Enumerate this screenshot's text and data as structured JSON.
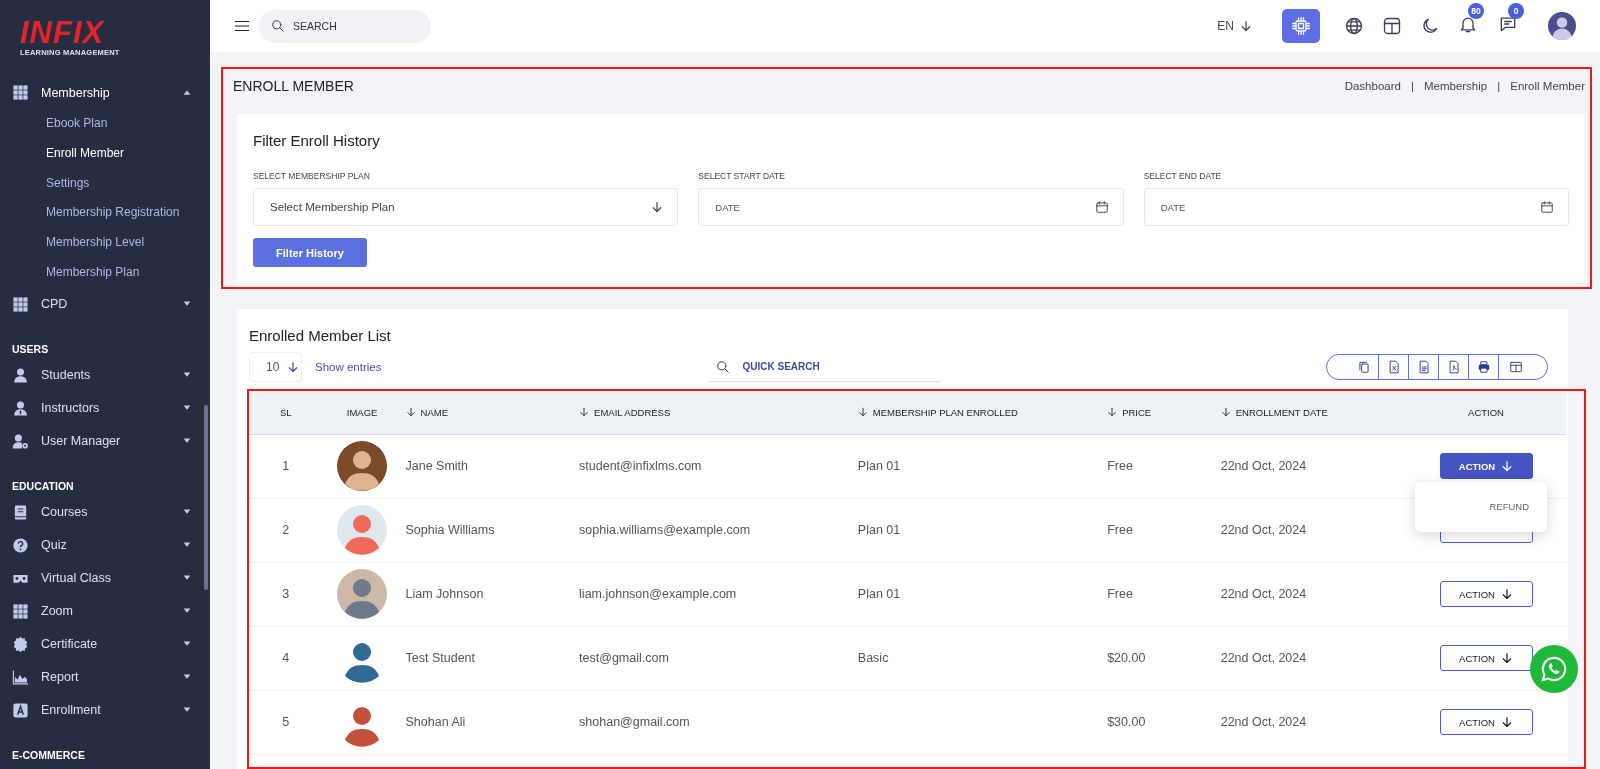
{
  "sidebar": {
    "logo": {
      "title": "INFIX",
      "subtitle": "LEARNING MANAGEMENT"
    },
    "sections": [
      {
        "items": [
          {
            "label": "Membership",
            "expanded": true,
            "children": [
              {
                "label": "Ebook Plan",
                "selected": false
              },
              {
                "label": "Enroll Member",
                "selected": true
              },
              {
                "label": "Settings",
                "selected": false
              },
              {
                "label": "Membership Registration",
                "selected": false
              },
              {
                "label": "Membership Level",
                "selected": false
              },
              {
                "label": "Membership Plan",
                "selected": false
              }
            ]
          },
          {
            "label": "CPD",
            "expanded": false
          }
        ]
      },
      {
        "heading": "USERS",
        "items": [
          {
            "label": "Students",
            "expanded": false
          },
          {
            "label": "Instructors",
            "expanded": false
          },
          {
            "label": "User Manager",
            "expanded": false
          }
        ]
      },
      {
        "heading": "EDUCATION",
        "items": [
          {
            "label": "Courses",
            "expanded": false
          },
          {
            "label": "Quiz",
            "expanded": false
          },
          {
            "label": "Virtual Class",
            "expanded": false
          },
          {
            "label": "Zoom",
            "expanded": false
          },
          {
            "label": "Certificate",
            "expanded": false
          },
          {
            "label": "Report",
            "expanded": false
          },
          {
            "label": "Enrollment",
            "expanded": false
          }
        ]
      },
      {
        "heading": "E-COMMERCE"
      }
    ]
  },
  "topbar": {
    "search": {
      "placeholder": "SEARCH"
    },
    "language": "EN",
    "badges": {
      "notifications": "80",
      "messages": "0"
    }
  },
  "page": {
    "title": "ENROLL MEMBER",
    "highlighted": true,
    "breadcrumb": [
      {
        "label": "Dashboard",
        "separator": "|"
      },
      {
        "label": "Membership",
        "separator": "|"
      },
      {
        "label": "Enroll Member"
      }
    ],
    "filter": {
      "title": "Filter Enroll History",
      "fields": [
        {
          "kind": "select",
          "label": "SELECT MEMBERSHIP PLAN",
          "placeholder": "Select Membership Plan"
        },
        {
          "kind": "date",
          "label": "SELECT START DATE",
          "placeholder": "DATE"
        },
        {
          "kind": "date",
          "label": "SELECT END DATE",
          "placeholder": "DATE"
        }
      ],
      "button": "Filter History"
    }
  },
  "list": {
    "title": "Enrolled Member List",
    "page_size": "10",
    "show_entries": "Show entries",
    "search": {
      "placeholder": "QUICK SEARCH"
    },
    "table": {
      "highlighted": true,
      "columns": [
        {
          "label": "SL",
          "sortable": false
        },
        {
          "label": "IMAGE",
          "sortable": false
        },
        {
          "label": "NAME",
          "sortable": true
        },
        {
          "label": "EMAIL ADDRESS",
          "sortable": true
        },
        {
          "label": "MEMBERSHIP PLAN ENROLLED",
          "sortable": true
        },
        {
          "label": "PRICE",
          "sortable": true
        },
        {
          "label": "ENROLLMENT DATE",
          "sortable": true
        },
        {
          "label": "ACTION",
          "sortable": false
        }
      ],
      "rows": [
        {
          "sl": "1",
          "name": "Jane Smith",
          "email": "student@infixlms.com",
          "plan": "Plan 01",
          "price": "Free",
          "date": "22nd Oct, 2024",
          "action": {
            "label": "ACTION",
            "active": true,
            "menu": [
              "REFUND"
            ]
          }
        },
        {
          "sl": "2",
          "name": "Sophia Williams",
          "email": "sophia.williams@example.com",
          "plan": "Plan 01",
          "price": "Free",
          "date": "22nd Oct, 2024",
          "action": {
            "active": false
          }
        },
        {
          "sl": "3",
          "name": "Liam Johnson",
          "email": "liam.johnson@example.com",
          "plan": "Plan 01",
          "price": "Free",
          "date": "22nd Oct, 2024",
          "action": {
            "label": "ACTION",
            "active": false
          }
        },
        {
          "sl": "4",
          "name": "Test Student",
          "email": "test@gmail.com",
          "plan": "Basic",
          "price": "$20.00",
          "date": "22nd Oct, 2024",
          "action": {
            "label": "ACTION",
            "active": false
          }
        },
        {
          "sl": "5",
          "name": "Shohan Ali",
          "email": "shohan@gmail.com",
          "price": "$30.00",
          "date": "22nd Oct, 2024",
          "action": {
            "label": "ACTION",
            "active": false
          }
        }
      ]
    }
  }
}
